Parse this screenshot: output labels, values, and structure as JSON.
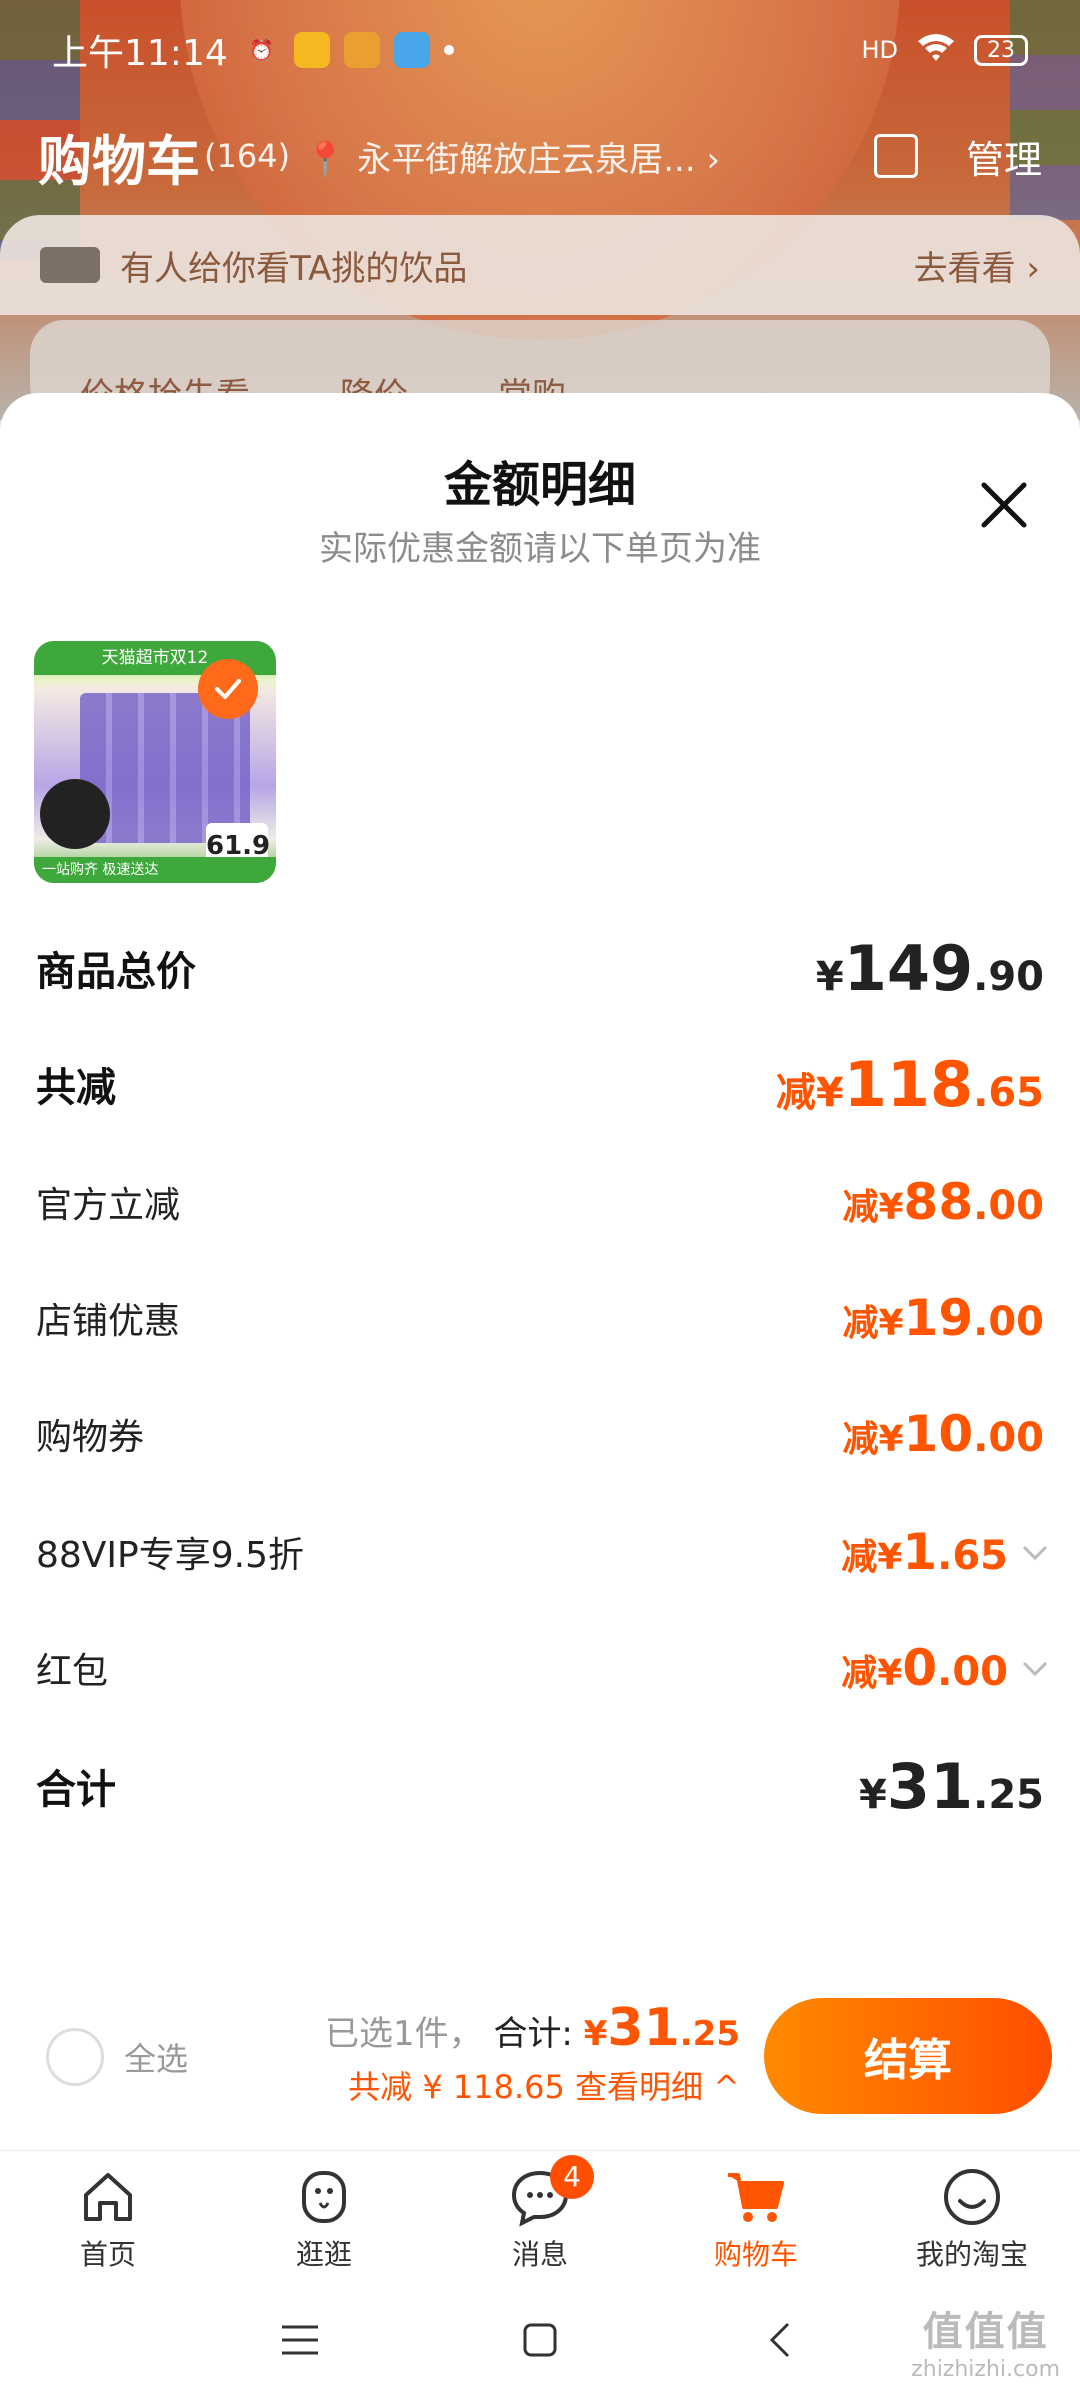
{
  "status_bar": {
    "time": "上午11:14",
    "battery": "23",
    "network": "HD"
  },
  "cart_header": {
    "title": "购物车",
    "count": "(164)",
    "address": "永平街解放庄云泉居...",
    "manage": "管理"
  },
  "promo_banner": {
    "text": "有人给你看TA挑的饮品",
    "action": "去看看"
  },
  "filter_strip": {
    "items": [
      "价格抢先看",
      "降价",
      "常购"
    ]
  },
  "sheet": {
    "title": "金额明细",
    "subtitle": "实际优惠金额请以下单页为准",
    "product": {
      "top_band": "天猫超市双12",
      "price_tag": "61.9",
      "bottom_band": "一站购齐 极速送达"
    },
    "rows": [
      {
        "label": "商品总价",
        "prefix": "¥",
        "int": "149",
        "dec": ".90"
      },
      {
        "label": "共减",
        "prefix": "减¥",
        "int": "118",
        "dec": ".65"
      },
      {
        "label": "官方立减",
        "prefix": "减¥",
        "int": "88",
        "dec": ".00"
      },
      {
        "label": "店铺优惠",
        "prefix": "减¥",
        "int": "19",
        "dec": ".00"
      },
      {
        "label": "购物券",
        "prefix": "减¥",
        "int": "10",
        "dec": ".00"
      },
      {
        "label": "88VIP专享9.5折",
        "prefix": "减¥",
        "int": "1",
        "dec": ".65"
      },
      {
        "label": "红包",
        "prefix": "减¥",
        "int": "0",
        "dec": ".00"
      },
      {
        "label": "合计",
        "prefix": "¥",
        "int": "31",
        "dec": ".25"
      }
    ]
  },
  "checkout": {
    "select_all": "全选",
    "selected": "已选1件，",
    "total_label": "合计:",
    "total_prefix": "¥",
    "total_int": "31",
    "total_dec": ".25",
    "discount_line": "共减 ¥ 118.65 查看明细 ^",
    "button": "结算"
  },
  "tabbar": {
    "items": [
      {
        "label": "首页",
        "icon": "home-icon"
      },
      {
        "label": "逛逛",
        "icon": "explore-icon"
      },
      {
        "label": "消息",
        "icon": "message-icon",
        "badge": "4"
      },
      {
        "label": "购物车",
        "icon": "cart-icon"
      },
      {
        "label": "我的淘宝",
        "icon": "profile-icon"
      }
    ],
    "active_index": 3
  },
  "watermark": {
    "big": "值值值",
    "small": "zhizhizhi.com"
  },
  "colors": {
    "accent": "#ff5500",
    "button_start": "#ff8a00",
    "button_end": "#ff4e00"
  }
}
